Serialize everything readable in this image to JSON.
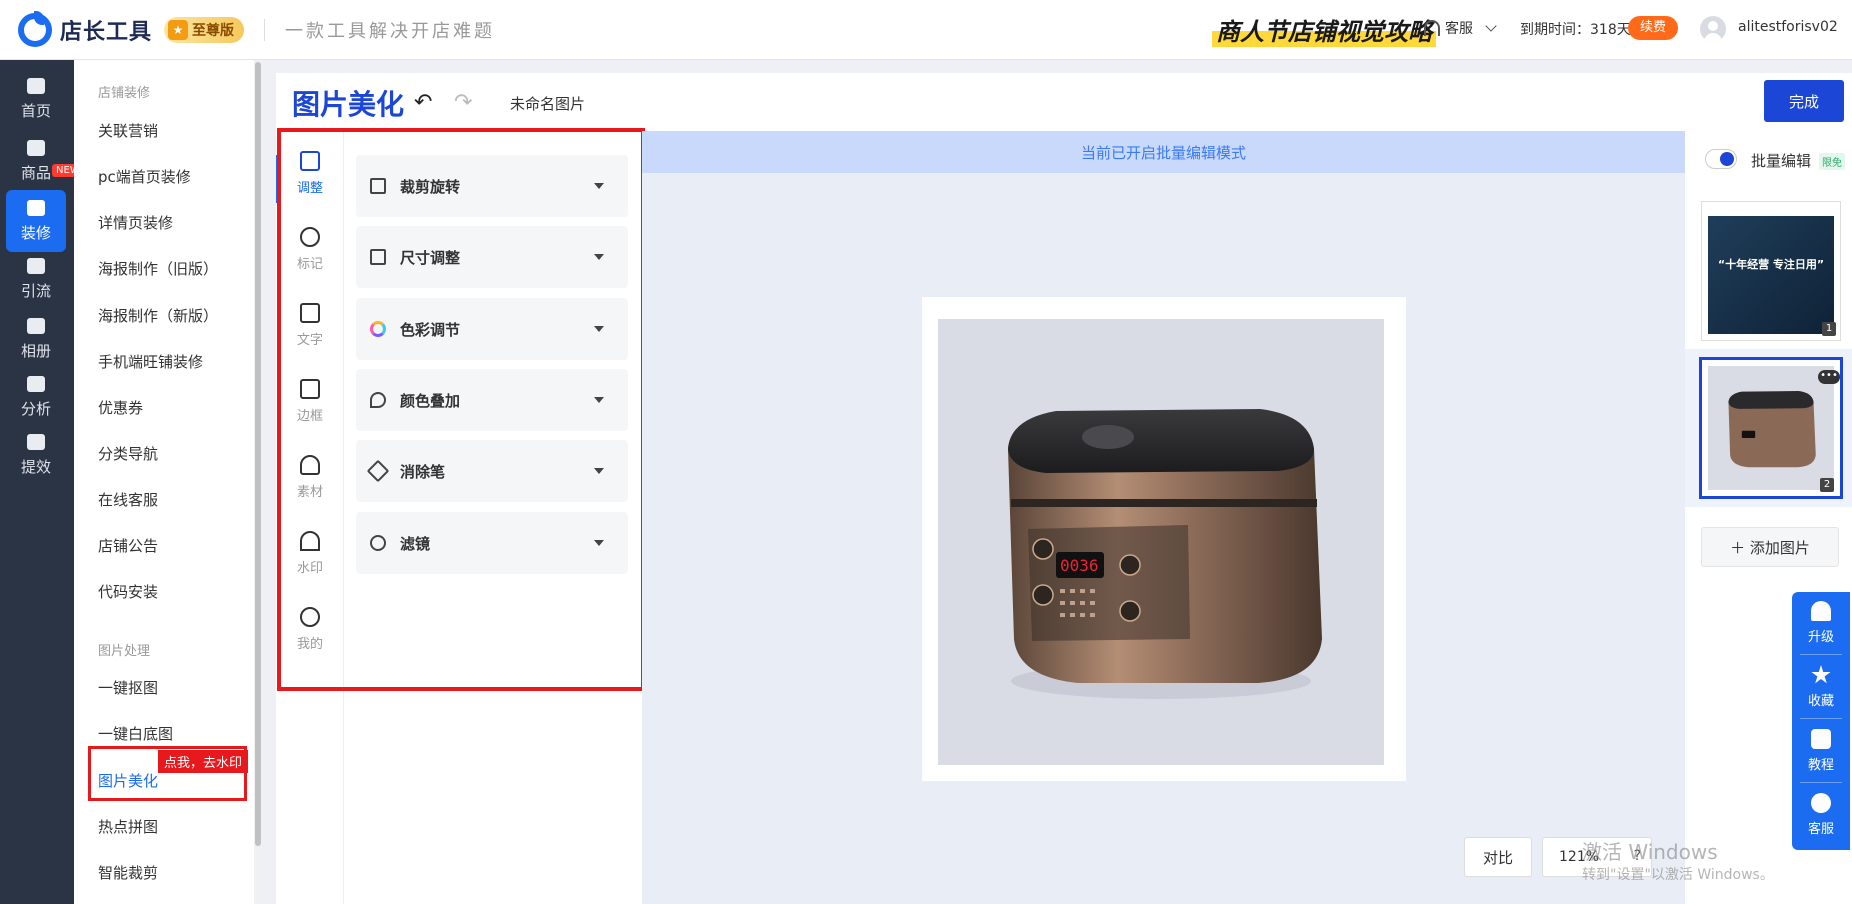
{
  "header": {
    "app_name": "店长工具",
    "vip_label": "至尊版",
    "slogan": "一款工具解决开店难题",
    "promo": "商人节店铺视觉攻略",
    "support": "客服",
    "expire_text": "到期时间：318天",
    "renew_label": "续费",
    "username": "alitestforisv02"
  },
  "leftnav": {
    "items": [
      {
        "label": "首页",
        "icon": "home-icon"
      },
      {
        "label": "商品",
        "icon": "bag-icon"
      },
      {
        "label": "装修",
        "icon": "decorate-icon"
      },
      {
        "label": "引流",
        "icon": "traffic-icon"
      },
      {
        "label": "相册",
        "icon": "album-icon"
      },
      {
        "label": "分析",
        "icon": "analytics-icon"
      },
      {
        "label": "提效",
        "icon": "clock-icon"
      }
    ],
    "new_tag": "NEW"
  },
  "submenu": {
    "group1": "店铺装修",
    "group1_items": [
      "关联营销",
      "pc端首页装修",
      "详情页装修",
      "海报制作（旧版）",
      "海报制作（新版）",
      "手机端旺铺装修",
      "优惠券",
      "分类导航",
      "在线客服",
      "店铺公告",
      "代码安装"
    ],
    "group2": "图片处理",
    "group2_items": [
      "一键抠图",
      "一键白底图",
      "图片美化",
      "热点拼图",
      "智能裁剪"
    ],
    "tip": "点我，去水印"
  },
  "editor": {
    "title": "图片美化",
    "undo": "↶",
    "redo": "↷",
    "doc_name": "未命名图片",
    "done_label": "完成"
  },
  "tools": [
    {
      "label": "调整",
      "icon": "sliders-icon"
    },
    {
      "label": "标记",
      "icon": "pen-icon"
    },
    {
      "label": "文字",
      "icon": "text-icon"
    },
    {
      "label": "边框",
      "icon": "border-icon"
    },
    {
      "label": "素材",
      "icon": "shapes-icon"
    },
    {
      "label": "水印",
      "icon": "stamp-icon"
    },
    {
      "label": "我的",
      "icon": "cloud-upload-icon"
    }
  ],
  "adjust": {
    "sections": [
      {
        "label": "裁剪旋转",
        "icon": "crop-icon"
      },
      {
        "label": "尺寸调整",
        "icon": "resize-icon"
      },
      {
        "label": "色彩调节",
        "icon": "color-wheel-icon"
      },
      {
        "label": "颜色叠加",
        "icon": "drops-icon"
      },
      {
        "label": "消除笔",
        "icon": "eraser-icon"
      },
      {
        "label": "滤镜",
        "icon": "filter-icon"
      }
    ]
  },
  "canvas": {
    "batch_banner": "当前已开启批量编辑模式",
    "compare_label": "对比",
    "zoom": "121%",
    "help": "?"
  },
  "right": {
    "batch_label": "批量编辑",
    "free_tag": "限免",
    "thumb1_text": "“十年经营 专注日用”",
    "thumb1_num": "1",
    "thumb2_num": "2",
    "more": "•••",
    "add_label": "＋ 添加图片"
  },
  "float": [
    {
      "label": "升级",
      "icon": "rocket-icon"
    },
    {
      "label": "收藏",
      "icon": "star-icon"
    },
    {
      "label": "教程",
      "icon": "book-icon"
    },
    {
      "label": "客服",
      "icon": "headset-icon"
    }
  ],
  "watermark": {
    "line1": "激活 Windows",
    "line2": "转到\"设置\"以激活 Windows。"
  }
}
